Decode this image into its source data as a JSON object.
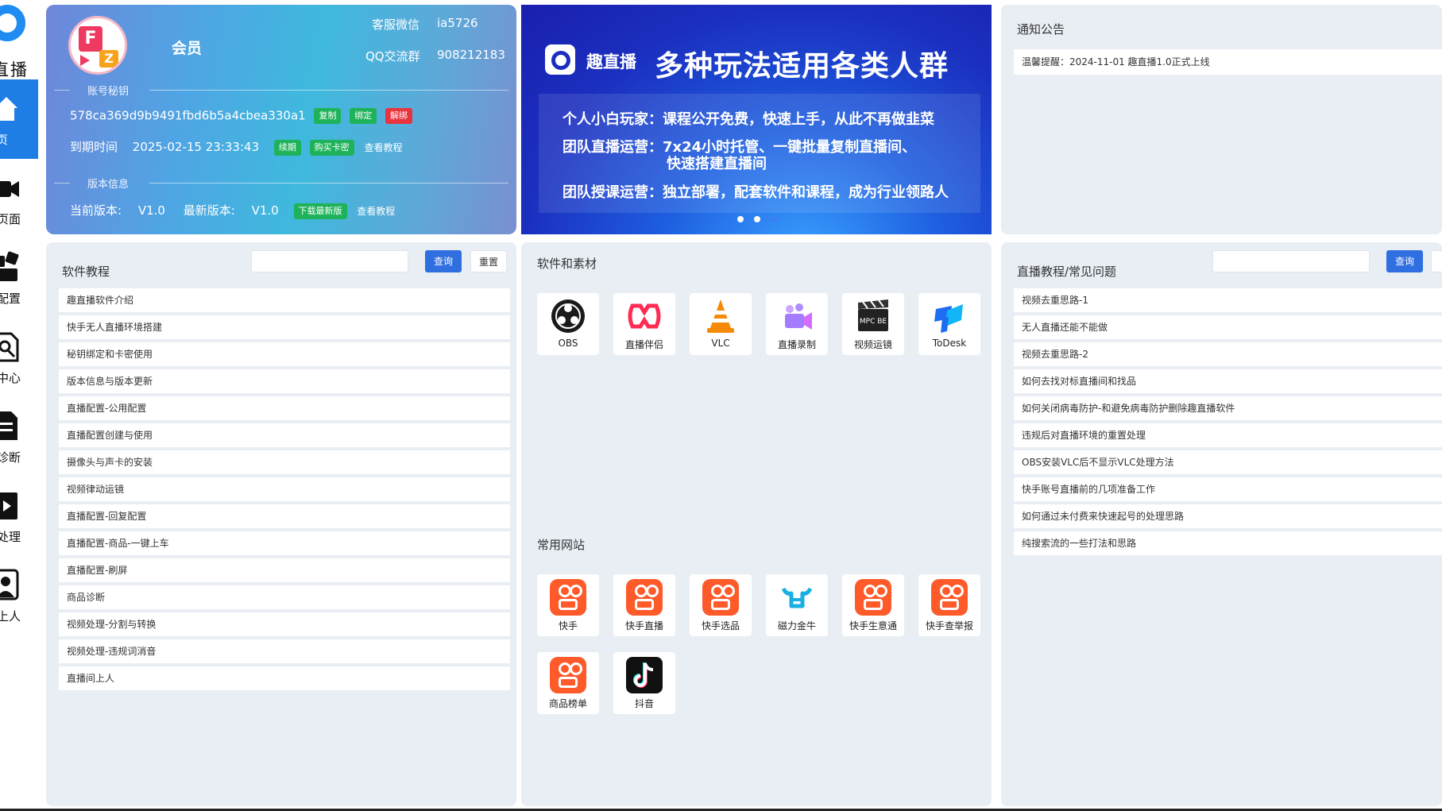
{
  "nav": {
    "logo_text": "直播",
    "items": [
      {
        "label": "页",
        "icon": "home-icon"
      },
      {
        "label": "页面",
        "icon": "camera-icon"
      },
      {
        "label": "配置",
        "icon": "config-icon"
      },
      {
        "label": "中心",
        "icon": "search-icon"
      },
      {
        "label": "诊断",
        "icon": "diagnosis-icon"
      },
      {
        "label": "处理",
        "icon": "video-icon"
      },
      {
        "label": "间上人",
        "icon": "user-icon"
      }
    ]
  },
  "account": {
    "member_label": "会员",
    "support_wechat_label": "客服微信",
    "support_wechat_value": "ia5726",
    "qq_group_label": "QQ交流群",
    "qq_group_value": "908212183",
    "key_section_label": "账号秘钥",
    "key_value": "578ca369d9b9491fbd6b5a4cbea330a1",
    "key_actions": [
      "复制",
      "绑定",
      "解绑"
    ],
    "expire_label": "到期时间",
    "expire_value": "2025-02-15 23:33:43",
    "expire_actions": [
      "续期",
      "购买卡密"
    ],
    "view_tutorial": "查看教程",
    "version_section_label": "版本信息",
    "current_version_label": "当前版本:",
    "current_version_value": "V1.0",
    "latest_version_label": "最新版本:",
    "latest_version_value": "V1.0",
    "download_latest": "下载最新版"
  },
  "banner": {
    "brand": "趣直播",
    "slogan": "多种玩法适用各类人群",
    "lines": [
      "个人小白玩家：课程公开免费，快速上手，从此不再做韭菜",
      "团队直播运营：7x24小时托管、一键批量复制直播间、",
      "快速搭建直播间",
      "团队授课运营：独立部署，配套软件和课程，成为行业领路人"
    ]
  },
  "notice": {
    "title": "通知公告",
    "item": "温馨提醒：2024-11-01 趣直播1.0正式上线"
  },
  "software_tutorials": {
    "title": "软件教程",
    "search_placeholder": "",
    "query_btn": "查询",
    "reset_btn": "重置",
    "items": [
      "趣直播软件介绍",
      "快手无人直播环境搭建",
      "秘钥绑定和卡密使用",
      "版本信息与版本更新",
      "直播配置-公用配置",
      "直播配置创建与使用",
      "摄像头与声卡的安装",
      "视频律动运镜",
      "直播配置-回复配置",
      "直播配置-商品-一键上车",
      "直播配置-刷屏",
      "商品诊断",
      "视频处理-分割与转换",
      "视频处理-违规词消音",
      "直播间上人"
    ]
  },
  "software_materials": {
    "title": "软件和素材",
    "apps": [
      {
        "label": "OBS",
        "icon": "obs-icon"
      },
      {
        "label": "直播伴侣",
        "icon": "live-companion-icon"
      },
      {
        "label": "VLC",
        "icon": "vlc-icon"
      },
      {
        "label": "直播录制",
        "icon": "live-record-icon"
      },
      {
        "label": "视频运镜",
        "icon": "mpc-be-icon"
      },
      {
        "label": "ToDesk",
        "icon": "todesk-icon"
      }
    ],
    "mpc_text": "MPC BE"
  },
  "websites": {
    "title": "常用网站",
    "items": [
      {
        "label": "快手",
        "icon": "kuaishou-icon"
      },
      {
        "label": "快手直播",
        "icon": "kuaishou-icon"
      },
      {
        "label": "快手选品",
        "icon": "kuaishou-icon"
      },
      {
        "label": "磁力金牛",
        "icon": "cili-jinniu-icon"
      },
      {
        "label": "快手生意通",
        "icon": "kuaishou-icon"
      },
      {
        "label": "快手查举报",
        "icon": "kuaishou-icon"
      },
      {
        "label": "商品榜单",
        "icon": "kuaishou-icon"
      },
      {
        "label": "抖音",
        "icon": "douyin-icon"
      }
    ]
  },
  "faq": {
    "title": "直播教程/常见问题",
    "search_placeholder": "",
    "query_btn": "查询",
    "items": [
      "视频去重思路-1",
      "无人直播还能不能做",
      "视频去重思路-2",
      "如何去找对标直播间和找品",
      "如何关闭病毒防护-和避免病毒防护删除趣直播软件",
      "违规后对直播环境的重置处理",
      "OBS安装VLC后不显示VLC处理方法",
      "快手账号直播前的几项准备工作",
      "如何通过未付费来快速起号的处理思路",
      "纯搜索流的一些打法和思路"
    ]
  },
  "colors": {
    "accent": "#1e7ee6",
    "panel_bg": "#e9eef5",
    "tag_green": "#1eb35a",
    "tag_red": "#e8343e",
    "kuaishou_orange": "#fe5a2a"
  }
}
